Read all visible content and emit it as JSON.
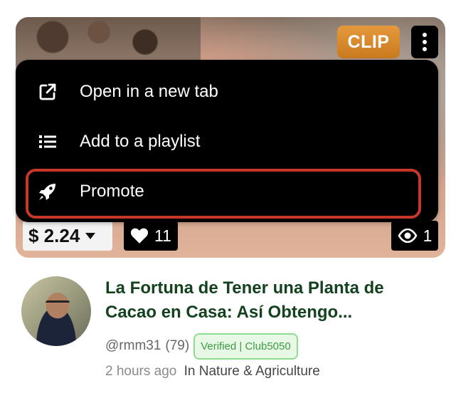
{
  "thumbnail": {
    "badge": "CLIP",
    "price": "$ 2.24",
    "likes": "11",
    "views": "1"
  },
  "menu": {
    "items": [
      {
        "label": "Open in a new tab",
        "icon": "external-link-icon"
      },
      {
        "label": "Add to a playlist",
        "icon": "list-icon"
      },
      {
        "label": "Promote",
        "icon": "rocket-icon",
        "highlighted": true
      }
    ]
  },
  "video": {
    "title": "La Fortuna de Tener una Planta de Cacao en Casa: Así Obtengo...",
    "author": "@rmm31",
    "reputation": "(79)",
    "verified_badge": "Verified | Club5050",
    "time_ago": "2 hours ago",
    "category": "In Nature & Agriculture"
  },
  "colors": {
    "title": "#14421f",
    "highlight_outline": "#c8382a",
    "clip_badge": "#d6862b",
    "verified_border": "#8fdc8f"
  }
}
